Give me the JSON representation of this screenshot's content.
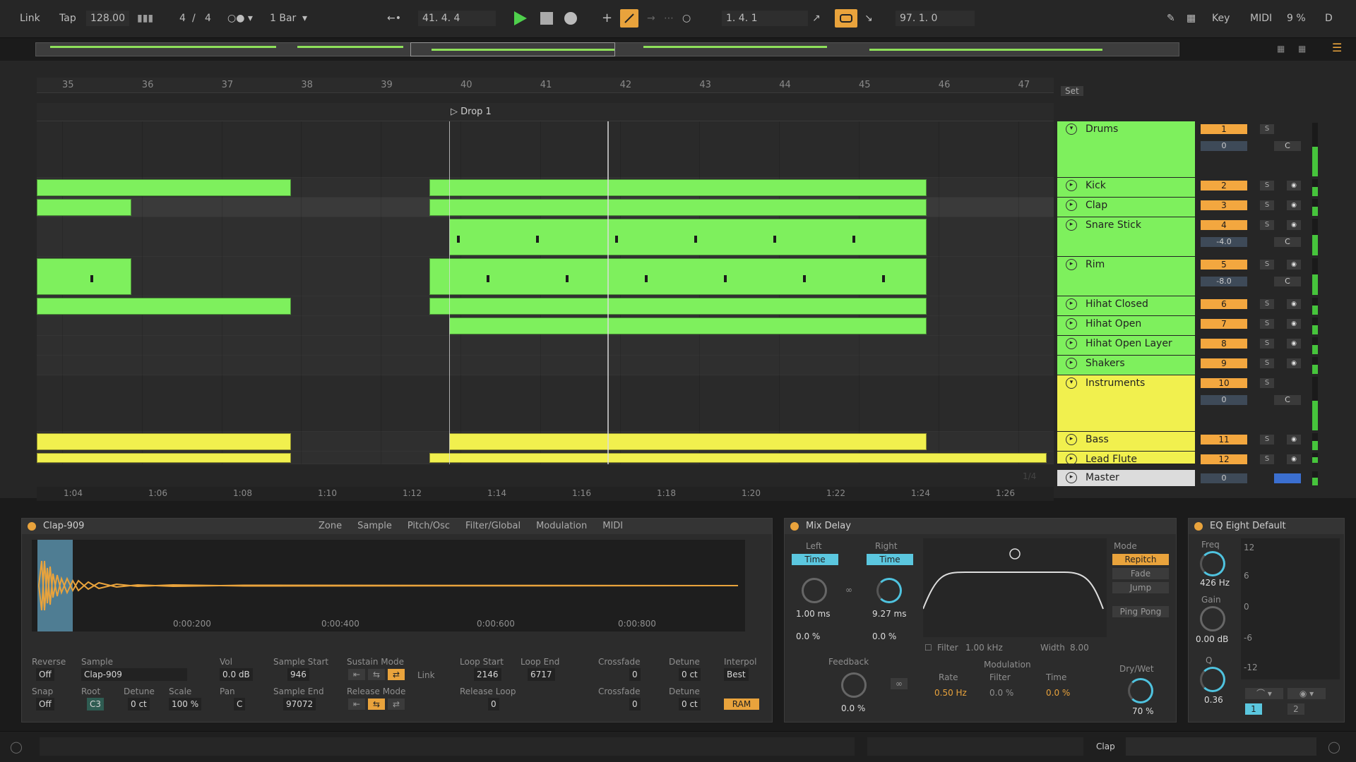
{
  "transport": {
    "link": "Link",
    "tap": "Tap",
    "tempo": "128.00",
    "time_sig_num": "4",
    "time_sig_sep": "/",
    "time_sig_den": "4",
    "quantize": "1 Bar",
    "position": "41.  4.  4",
    "loop_start": "1.  4.  1",
    "loop_length": "97.  1.  0",
    "key": "Key",
    "midi": "MIDI",
    "cpu": "9 %",
    "disk": "D",
    "accent": "#e9a33c",
    "play_color": "#4fd04c"
  },
  "arrangement": {
    "bar_numbers": [
      "35",
      "36",
      "37",
      "38",
      "39",
      "40",
      "41",
      "42",
      "43",
      "44",
      "45",
      "46",
      "47"
    ],
    "locator": "Drop 1",
    "set_label": "Set",
    "time_labels": [
      "1:04",
      "1:06",
      "1:08",
      "1:10",
      "1:12",
      "1:14",
      "1:16",
      "1:18",
      "1:20",
      "1:22",
      "1:24",
      "1:26"
    ],
    "track_fraction": "1/4"
  },
  "tracks": [
    {
      "name": "Drums",
      "number": "1",
      "vol": "0",
      "pan": "C",
      "solo": "S",
      "color": "green",
      "group": true
    },
    {
      "name": "Kick",
      "number": "2",
      "solo": "S",
      "color": "green"
    },
    {
      "name": "Clap",
      "number": "3",
      "solo": "S",
      "color": "green"
    },
    {
      "name": "Snare Stick",
      "number": "4",
      "vol": "-4.0",
      "pan": "C",
      "solo": "S",
      "color": "green"
    },
    {
      "name": "Rim",
      "number": "5",
      "vol": "-8.0",
      "pan": "C",
      "solo": "S",
      "color": "green"
    },
    {
      "name": "Hihat Closed",
      "number": "6",
      "solo": "S",
      "color": "green"
    },
    {
      "name": "Hihat Open",
      "number": "7",
      "solo": "S",
      "color": "green"
    },
    {
      "name": "Hihat Open Layer",
      "number": "8",
      "solo": "S",
      "color": "green"
    },
    {
      "name": "Shakers",
      "number": "9",
      "solo": "S",
      "color": "green"
    },
    {
      "name": "Instruments",
      "number": "10",
      "vol": "0",
      "pan": "C",
      "solo": "S",
      "color": "yellow",
      "group": true
    },
    {
      "name": "Bass",
      "number": "11",
      "solo": "S",
      "color": "yellow"
    },
    {
      "name": "Lead Flute",
      "number": "12",
      "solo": "S",
      "color": "yellow"
    },
    {
      "name": "Master",
      "number": "0",
      "vol": "0",
      "color": "white"
    }
  ],
  "sampler": {
    "title": "Clap-909",
    "tabs": [
      "Zone",
      "Sample",
      "Pitch/Osc",
      "Filter/Global",
      "Modulation",
      "MIDI"
    ],
    "waveform_times": [
      "0:00:200",
      "0:00:400",
      "0:00:600",
      "0:00:800"
    ],
    "reverse_label": "Reverse",
    "reverse_value": "Off",
    "snap_label": "Snap",
    "snap_value": "Off",
    "sample_label": "Sample",
    "sample_value": "Clap-909",
    "root_label": "Root",
    "root_value": "C3",
    "detune_label": "Detune",
    "detune_value": "0 ct",
    "scale_label": "Scale",
    "scale_value": "100 %",
    "vol_label": "Vol",
    "vol_value": "0.0 dB",
    "pan_label": "Pan",
    "pan_value": "C",
    "sample_start_label": "Sample Start",
    "sample_start_value": "946",
    "sample_end_label": "Sample End",
    "sample_end_value": "97072",
    "sustain_mode_label": "Sustain Mode",
    "release_mode_label": "Release Mode",
    "link_label": "Link",
    "loop_start_label": "Loop Start",
    "loop_start_value": "2146",
    "loop_end_label": "Loop End",
    "loop_end_value": "6717",
    "release_loop_label": "Release Loop",
    "release_loop_value": "0",
    "crossfade_label": "Crossfade",
    "crossfade_value": "0",
    "crossfade2_value": "0",
    "detune2_label": "Detune",
    "detune2_value": "0 ct",
    "detune3_value": "0 ct",
    "interpol_label": "Interpol",
    "interpol_value": "Best",
    "ram_label": "RAM"
  },
  "delay": {
    "title": "Mix Delay",
    "left_label": "Left",
    "right_label": "Right",
    "time_btn": "Time",
    "left_time": "1.00 ms",
    "right_time": "9.27 ms",
    "left_offset": "0.0 %",
    "right_offset": "0.0 %",
    "filter_label": "Filter",
    "filter_freq": "1.00 kHz",
    "width_label": "Width",
    "width_value": "8.00",
    "feedback_label": "Feedback",
    "feedback_value": "0.0 %",
    "modulation_label": "Modulation",
    "rate_label": "Rate",
    "rate_value": "0.50 Hz",
    "mod_filter_label": "Filter",
    "mod_filter_value": "0.0 %",
    "mod_time_label": "Time",
    "mod_time_value": "0.0 %",
    "mode_label": "Mode",
    "modes": [
      "Repitch",
      "Fade",
      "Jump"
    ],
    "pingpong": "Ping Pong",
    "drywet_label": "Dry/Wet",
    "drywet_value": "70 %"
  },
  "eq": {
    "title": "EQ Eight Default",
    "freq_label": "Freq",
    "freq_value": "426 Hz",
    "gain_label": "Gain",
    "gain_value": "0.00 dB",
    "q_label": "Q",
    "q_value": "0.36",
    "db_marks": [
      "12",
      "6",
      "0",
      "-6",
      "-12"
    ],
    "band_a": "1",
    "band_b": "2"
  },
  "status": {
    "clip_label": "Clap"
  }
}
